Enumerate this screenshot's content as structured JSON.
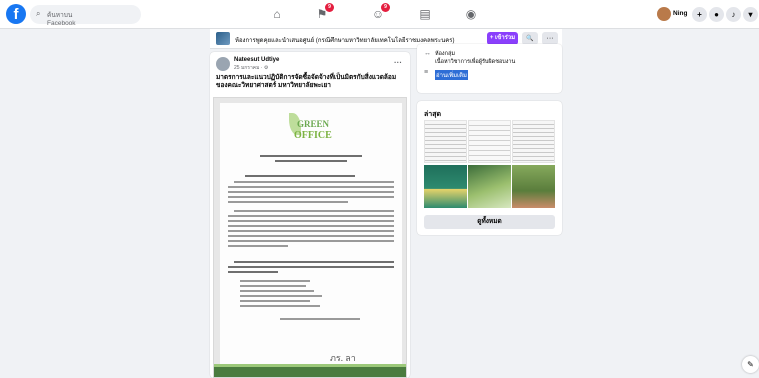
{
  "topbar": {
    "logo": "f",
    "search_placeholder": "ค้นหาบน Facebook",
    "nav": [
      {
        "icon": "home-icon",
        "glyph": "⌂",
        "badge": ""
      },
      {
        "icon": "flag-icon",
        "glyph": "⚑",
        "badge": "9"
      },
      {
        "icon": "groups-icon",
        "glyph": "☺",
        "badge": "9"
      },
      {
        "icon": "marketplace-icon",
        "glyph": "▤",
        "badge": ""
      },
      {
        "icon": "gaming-icon",
        "glyph": "◉",
        "badge": ""
      }
    ],
    "profile_name": "Ning",
    "actions": [
      "+",
      "●",
      "♪",
      "▾"
    ]
  },
  "pagebar": {
    "title": "ห้องการพูดคุยและนำเสนอศูนย์ (กรณีศึกษามหาวิทยาลัยเทคโนโลยีราชมงคลพระนคร)",
    "join_label": "+ เข้าร่วม",
    "search_glyph": "🔍",
    "more_glyph": "···"
  },
  "post": {
    "author": "Nateesut Udtiye",
    "time": "25 มกราคม · ⚙",
    "more": "···",
    "caption": "มาตรการและแนวปฏิบัติการจัดซื้อจัดจ้างที่เป็นมิตรกับสิ่งแวดล้อมของคณะวิทยาศาสตร์ มหาวิทยาลัยพะเยา",
    "doc_logo_top": "GREEN",
    "doc_logo_bottom": "OFFICE",
    "signature": "ภร. ลา"
  },
  "info": {
    "line1": "ห้องกลุ่ม",
    "line2": "เนื้อหาวิชาการเพื่อผู้รับผิดชอบงาน",
    "link": "อ่านเพิ่มเติม"
  },
  "photos": {
    "title": "ล่าสุด",
    "see_all": "ดูทั้งหมด"
  },
  "chat_glyph": "✎"
}
